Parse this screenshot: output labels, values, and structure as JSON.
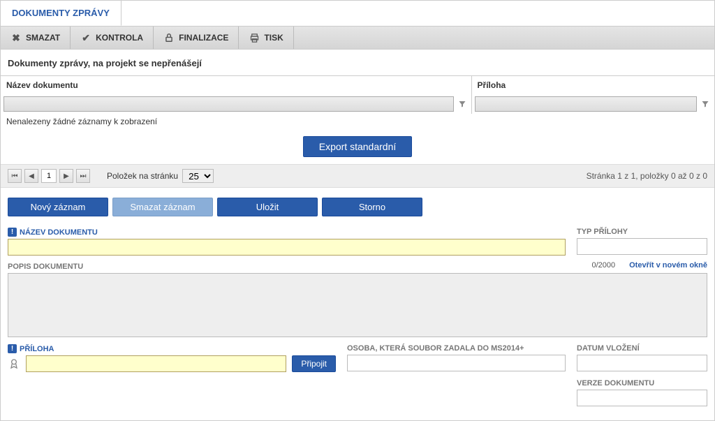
{
  "tab_title": "DOKUMENTY ZPRÁVY",
  "toolbar": {
    "smazat": "SMAZAT",
    "kontrola": "KONTROLA",
    "finalizace": "FINALIZACE",
    "tisk": "TISK"
  },
  "subtitle": "Dokumenty zprávy, na projekt se nepřenášejí",
  "grid": {
    "col_nazev": "Název dokumentu",
    "col_priloha": "Příloha",
    "no_records": "Nenalezeny žádné záznamy k zobrazení"
  },
  "export_btn": "Export standardní",
  "pager": {
    "page": "1",
    "page_size_label": "Položek na stránku",
    "page_size": "25",
    "summary": "Stránka 1 z 1, položky 0 až 0 z 0"
  },
  "actions": {
    "novy": "Nový záznam",
    "smazat": "Smazat záznam",
    "ulozit": "Uložit",
    "storno": "Storno"
  },
  "form": {
    "nazev_label": "NÁZEV DOKUMENTU",
    "typ_label": "TYP PŘÍLOHY",
    "popis_label": "POPIS DOKUMENTU",
    "counter": "0/2000",
    "open_new": "Otevřít v novém okně",
    "priloha_label": "PŘÍLOHA",
    "pripojit": "Připojit",
    "osoba_label": "OSOBA, KTERÁ SOUBOR ZADALA DO MS2014+",
    "datum_label": "DATUM VLOŽENÍ",
    "verze_label": "VERZE DOKUMENTU"
  }
}
